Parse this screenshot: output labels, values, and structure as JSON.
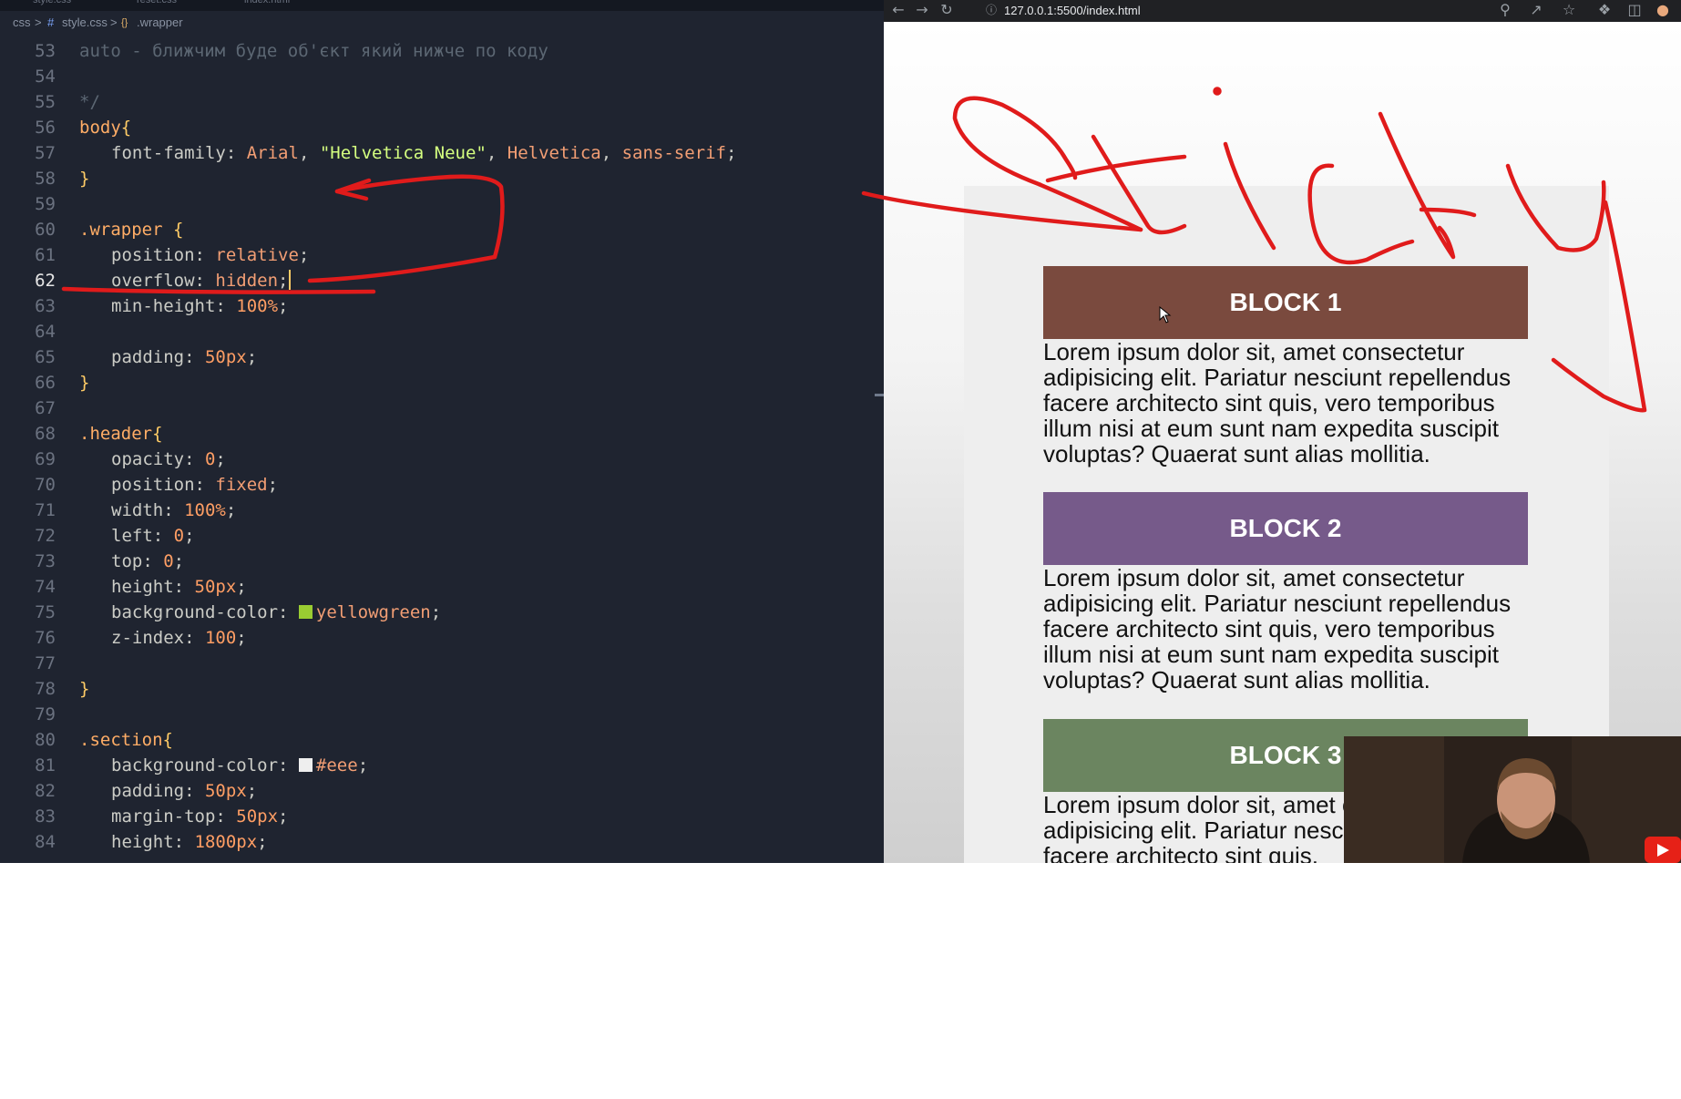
{
  "editor": {
    "tabs": [
      "style.css",
      "reset.css",
      "index.html"
    ],
    "breadcrumb": {
      "folder": "css",
      "sep1": ">",
      "file_icon": "#",
      "file": "style.css",
      "sep2": ">",
      "symbol_icon": "{}",
      "symbol": ".wrapper"
    },
    "active_line": 62,
    "swatches": {
      "yellowgreen": "#9acd32",
      "eee": "#eeeeee"
    },
    "lines": [
      {
        "n": "53",
        "t": "auto - ближчим буде об'єкт який нижче по коду"
      },
      {
        "n": "54",
        "t": ""
      },
      {
        "n": "55",
        "t": "*/"
      },
      {
        "n": "56",
        "t": "body{"
      },
      {
        "n": "57",
        "t": "font-family: Arial, \"Helvetica Neue\", Helvetica, sans-serif;"
      },
      {
        "n": "58",
        "t": "}"
      },
      {
        "n": "59",
        "t": ""
      },
      {
        "n": "60",
        "t": ".wrapper {"
      },
      {
        "n": "61",
        "t": "position: relative;"
      },
      {
        "n": "62",
        "t": "overflow: hidden;"
      },
      {
        "n": "63",
        "t": "min-height: 100%;"
      },
      {
        "n": "64",
        "t": ""
      },
      {
        "n": "65",
        "t": "padding: 50px;"
      },
      {
        "n": "66",
        "t": "}"
      },
      {
        "n": "67",
        "t": ""
      },
      {
        "n": "68",
        "t": ".header{"
      },
      {
        "n": "69",
        "t": "opacity: 0;"
      },
      {
        "n": "70",
        "t": "position: fixed;"
      },
      {
        "n": "71",
        "t": "width: 100%;"
      },
      {
        "n": "72",
        "t": "left: 0;"
      },
      {
        "n": "73",
        "t": "top: 0;"
      },
      {
        "n": "74",
        "t": "height: 50px;"
      },
      {
        "n": "75",
        "t": "background-color: yellowgreen;"
      },
      {
        "n": "76",
        "t": "z-index: 100;"
      },
      {
        "n": "77",
        "t": ""
      },
      {
        "n": "78",
        "t": "}"
      },
      {
        "n": "79",
        "t": ""
      },
      {
        "n": "80",
        "t": ".section{"
      },
      {
        "n": "81",
        "t": "background-color: #eee;"
      },
      {
        "n": "82",
        "t": "padding: 50px;"
      },
      {
        "n": "83",
        "t": "margin-top: 50px;"
      },
      {
        "n": "84",
        "t": "height: 1800px;"
      }
    ]
  },
  "browser": {
    "url": "127.0.0.1:5500/index.html",
    "icons": [
      "back-icon",
      "forward-icon",
      "reload-icon",
      "info-icon",
      "zoom-icon",
      "share-icon",
      "star-icon",
      "extensions-icon",
      "sidepanel-icon",
      "profile-icon"
    ],
    "blocks": [
      {
        "title": "BLOCK 1",
        "color": "#7a4a3e",
        "text": "Lorem ipsum dolor sit, amet consectetur adipisicing elit. Pariatur nesciunt repellendus facere architecto sint quis, vero temporibus illum nisi at eum sunt nam expedita suscipit voluptas? Quaerat sunt alias mollitia."
      },
      {
        "title": "BLOCK 2",
        "color": "#765a8a",
        "text": "Lorem ipsum dolor sit, amet consectetur adipisicing elit. Pariatur nesciunt repellendus facere architecto sint quis, vero temporibus illum nisi at eum sunt nam expedita suscipit voluptas? Quaerat sunt alias mollitia."
      },
      {
        "title": "BLOCK 3",
        "color": "#6b8560",
        "text": "Lorem ipsum dolor sit, amet consectetur adipisicing elit. Pariatur nesciunt repellendus facere architecto sint quis,"
      }
    ]
  },
  "annotation": {
    "color": "#e01b1b"
  },
  "video": {
    "icons": [
      "webcam-feed",
      "youtube-play-icon"
    ]
  }
}
